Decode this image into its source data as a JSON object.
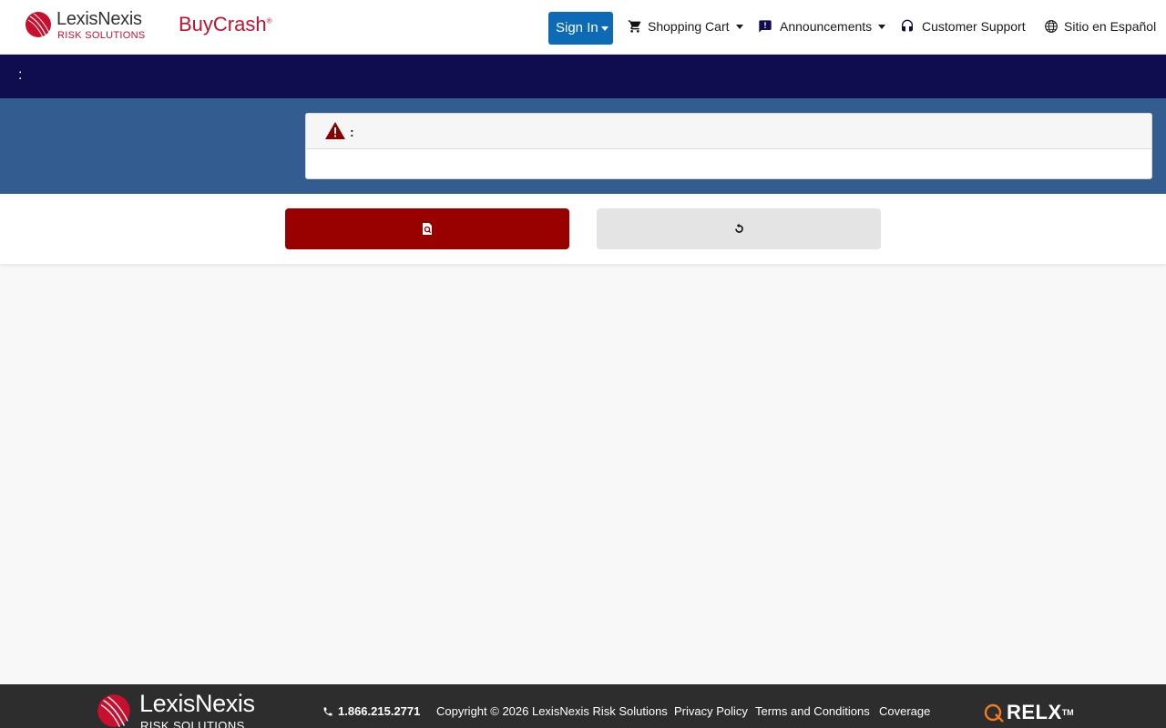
{
  "header": {
    "brand_name": "LexisNexis",
    "brand_sub": "RISK SOLUTIONS",
    "product_name": "BuyCrash",
    "nav": {
      "signin_label": "Sign In",
      "cart_label": "Shopping Cart",
      "announcements_label": "Announcements",
      "support_label": "Customer Support",
      "language_label": "Sitio en Español"
    }
  },
  "title_band": {
    "text": ":"
  },
  "alert": {
    "header_text": ":"
  },
  "footer": {
    "brand_name": "LexisNexis",
    "brand_sub": "RISK SOLUTIONS",
    "phone": "1.866.215.2771",
    "copyright": "Copyright © 2026 LexisNexis Risk Solutions",
    "privacy": "Privacy Policy",
    "terms": "Terms and Conditions",
    "coverage": "Coverage",
    "parent_brand": "RELX"
  },
  "colors": {
    "brand_red": "#c8102e",
    "signin_blue": "#0d6ab7",
    "title_navy": "#0f0c50",
    "band_blue": "#335d91",
    "search_button": "#990000",
    "footer_bg": "#2d2d2d"
  },
  "icons": {
    "cart": "shopping-cart-icon",
    "announcements": "announcement-icon",
    "support": "headset-icon",
    "language": "globe-icon",
    "alert": "warning-triangle-icon",
    "search_button": "document-search-icon",
    "reset_button": "refresh-icon",
    "phone": "phone-icon"
  }
}
